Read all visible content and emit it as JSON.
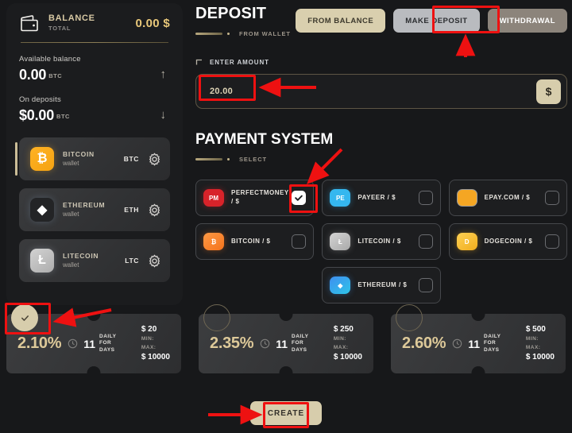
{
  "sidebar": {
    "balance": {
      "icon": "wallet-icon",
      "title": "BALANCE",
      "subtitle": "TOTAL",
      "amount": "0.00 $"
    },
    "stats": [
      {
        "label": "Available balance",
        "value": "0.00",
        "unit": "BTC",
        "arrow": "↑"
      },
      {
        "label": "On deposits",
        "value": "$0.00",
        "unit": "BTC",
        "arrow": "↓"
      }
    ],
    "wallets": [
      {
        "name": "BITCOIN",
        "sub": "wallet",
        "ticker": "BTC",
        "symbol": "₿",
        "active": true
      },
      {
        "name": "ETHEREUM",
        "sub": "wallet",
        "ticker": "ETH",
        "symbol": "◆",
        "active": false
      },
      {
        "name": "LITECOIN",
        "sub": "wallet",
        "ticker": "LTC",
        "symbol": "Ł",
        "active": false
      }
    ]
  },
  "main": {
    "title": "DEPOSIT",
    "breadcrumb": "FROM WALLET",
    "tabs": [
      {
        "label": "FROM BALANCE",
        "style": "cream"
      },
      {
        "label": "MAKE DEPOSIT",
        "style": "active"
      },
      {
        "label": "WITHDRAWAL",
        "style": "muted"
      }
    ],
    "amount": {
      "label": "ENTER AMOUNT",
      "value": "20.00",
      "placeholder": "0.00",
      "currency_button": "$"
    },
    "payment": {
      "title": "PAYMENT SYSTEM",
      "breadcrumb": "SELECT",
      "options": [
        {
          "name": "PERFECTMONEY / $",
          "icon": "perfectmoney-icon",
          "badge": "PM",
          "checked": true
        },
        {
          "name": "PAYEER / $",
          "icon": "payeer-icon",
          "badge": "PE",
          "checked": false
        },
        {
          "name": "EPAY.COM / $",
          "icon": "epay-icon",
          "badge": "",
          "checked": false
        },
        {
          "name": "BITCOIN / $",
          "icon": "bitcoin-icon",
          "badge": "₿",
          "checked": false
        },
        {
          "name": "LITECOIN / $",
          "icon": "litecoin-icon",
          "badge": "Ł",
          "checked": false
        },
        {
          "name": "DOGECOIN / $",
          "icon": "dogecoin-icon",
          "badge": "D",
          "checked": false
        },
        {
          "name": "ETHEREUM / $",
          "icon": "ethereum-icon",
          "badge": "◆",
          "checked": false
        }
      ]
    }
  },
  "plans": [
    {
      "percent": "2.10%",
      "days": "11",
      "days_label": "DAILY\nFOR\nDAYS",
      "min_value": "$ 20",
      "min_label": "MIN:",
      "max_label": "MAX:",
      "max_value": "$ 10000",
      "selected": true
    },
    {
      "percent": "2.35%",
      "days": "11",
      "days_label": "DAILY\nFOR\nDAYS",
      "min_value": "$ 250",
      "min_label": "MIN:",
      "max_label": "MAX:",
      "max_value": "$ 10000",
      "selected": false
    },
    {
      "percent": "2.60%",
      "days": "11",
      "days_label": "DAILY\nFOR\nDAYS",
      "min_value": "$ 500",
      "min_label": "MIN:",
      "max_label": "MAX:",
      "max_value": "$ 10000",
      "selected": false
    }
  ],
  "footer": {
    "create_label": "CREATE"
  },
  "colors": {
    "background": "#17181a",
    "panel": "#1b1c1e",
    "accent_gold": "#ddc999",
    "accent_cream": "#d7cdac",
    "active_tab": "#b9bbbf",
    "annotation": "#ee1111"
  }
}
